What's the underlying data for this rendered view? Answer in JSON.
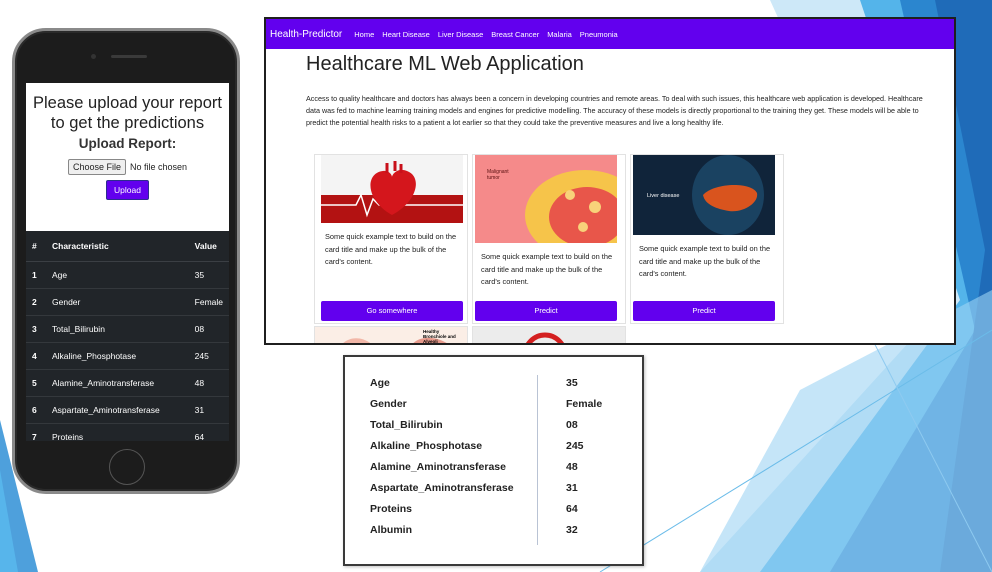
{
  "phone": {
    "upload_title": "Please upload your report to get the predictions",
    "upload_subtitle": "Upload Report:",
    "choose_file_label": "Choose File",
    "no_file_text": "No file chosen",
    "upload_button_label": "Upload",
    "table": {
      "headers": [
        "#",
        "Characteristic",
        "Value"
      ],
      "rows": [
        {
          "num": "1",
          "name": "Age",
          "value": "35"
        },
        {
          "num": "2",
          "name": "Gender",
          "value": "Female"
        },
        {
          "num": "3",
          "name": "Total_Bilirubin",
          "value": "08"
        },
        {
          "num": "4",
          "name": "Alkaline_Phosphotase",
          "value": "245"
        },
        {
          "num": "5",
          "name": "Alamine_Aminotransferase",
          "value": "48"
        },
        {
          "num": "6",
          "name": "Aspartate_Aminotransferase",
          "value": "31"
        },
        {
          "num": "7",
          "name": "Proteins",
          "value": "64"
        }
      ]
    }
  },
  "browser": {
    "brand": "Health-Predictor",
    "nav_links": [
      "Home",
      "Heart Disease",
      "Liver Disease",
      "Breast Cancer",
      "Malaria",
      "Pneumonia"
    ],
    "title": "Healthcare ML Web Application",
    "intro": "Access to quality healthcare and doctors has always been a concern in developing countries and remote areas. To deal with such issues, this healthcare web application is developed. Healthcare data was fed to machine learning training models and engines for predictive modelling. The accuracy of these models is directly proportional to the training they get. These models will be able to predict the potential health risks to a patient a lot earlier so that they could take the preventive measures and live a long healthy life.",
    "cards": [
      {
        "text": "Some quick example text to build on the card title and make up the bulk of the card's content.",
        "button": "Go somewhere",
        "image_label": ""
      },
      {
        "text": "Some quick example text to build on the card title and make up the bulk of the card's content.",
        "button": "Predict",
        "image_label": "Malignant tumor"
      },
      {
        "text": "Some quick example text to build on the card title and make up the bulk of the card's content.",
        "button": "Predict",
        "image_label": "Liver disease"
      }
    ],
    "second_row_image_label": "Healthy Bronchiole and Alveoli"
  },
  "values_table": [
    {
      "key": "Age",
      "value": "35"
    },
    {
      "key": "Gender",
      "value": "Female"
    },
    {
      "key": "Total_Bilirubin",
      "value": "08"
    },
    {
      "key": "Alkaline_Phosphotase",
      "value": "245"
    },
    {
      "key": "Alamine_Aminotransferase",
      "value": "48"
    },
    {
      "key": "Aspartate_Aminotransferase",
      "value": "31"
    },
    {
      "key": "Proteins",
      "value": "64"
    },
    {
      "key": "Albumin",
      "value": "32"
    }
  ],
  "colors": {
    "accent": "#6200ee",
    "table_dark": "#212529",
    "slide_blue": "#3b9fe3"
  }
}
